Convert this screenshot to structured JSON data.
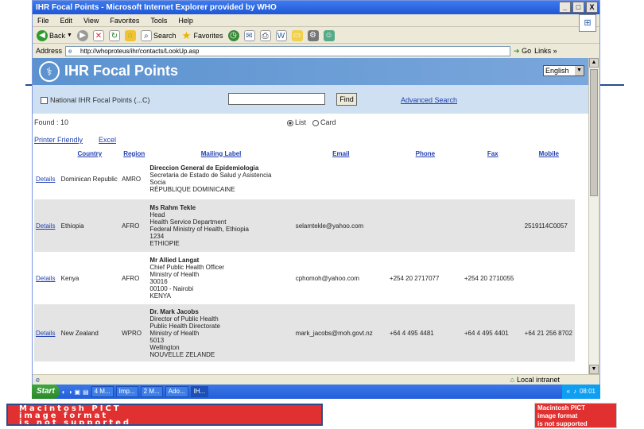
{
  "window": {
    "title": "IHR Focal Points - Microsoft Internet Explorer provided by WHO",
    "min": "_",
    "max": "□",
    "close": "X",
    "menus": [
      "File",
      "Edit",
      "View",
      "Favorites",
      "Tools",
      "Help"
    ],
    "toolbar": {
      "back": "Back",
      "search": "Search",
      "favorites": "Favorites"
    },
    "address_label": "Address",
    "address_value": "http://whoproteus/ihr/contacts/LookUp.asp",
    "go": "Go",
    "links": "Links »"
  },
  "site": {
    "title": "IHR Focal Points",
    "language": "English",
    "search": {
      "checkbox_label": "National IHR Focal Points (...C)",
      "find_button": "Find",
      "advanced_link": "Advanced Search"
    },
    "found_text": "Found : 10",
    "radio_list": "List",
    "radio_card": "Card",
    "printer_friendly": "Printer Friendly",
    "excel": "Excel",
    "columns": [
      "",
      "Country",
      "Region",
      "Mailing Label",
      "Email",
      "Phone",
      "Fax",
      "Mobile"
    ],
    "rows": [
      {
        "details": "Details",
        "country": "Dominican Republic",
        "region": "AMRO",
        "label": [
          "Direccion General de Epidemiologia",
          "Secretaria de Estado de Salud y Asistencia",
          "Socia",
          "RÉPUBLIQUE DOMINICAINE"
        ],
        "email": "",
        "phone": "",
        "fax": "",
        "mobile": ""
      },
      {
        "details": "Details",
        "country": "Ethiopia",
        "region": "AFRO",
        "label": [
          "Ms Rahm Tekle",
          "Head",
          "Health Service Department",
          "Federal Ministry of Health, Ethiopia",
          "1234",
          "ETHIOPIE"
        ],
        "email": "selamtekle@yahoo.com",
        "phone": "",
        "fax": "",
        "mobile": "2519114C0057"
      },
      {
        "details": "Details",
        "country": "Kenya",
        "region": "AFRO",
        "label": [
          "Mr Allied Langat",
          "Chief Public Health Officer",
          "Ministry of Health",
          "30016",
          "00100 - Nairobi",
          "KENYA"
        ],
        "email": "cphomoh@yahoo.com",
        "phone": "+254 20 2717077",
        "fax": "+254 20 2710055",
        "mobile": ""
      },
      {
        "details": "Details",
        "country": "New Zealand",
        "region": "WPRO",
        "label": [
          "Dr. Mark Jacobs",
          "Director of Public Health",
          "Public Health Directorate",
          "Ministry of Health",
          "5013",
          "Wellington",
          "NOUVELLE ZELANDE"
        ],
        "email": "mark_jacobs@moh.govt.nz",
        "phone": "+64 4 495 4481",
        "fax": "+64 4 495 4401",
        "mobile": "+64 21 256 8702"
      }
    ]
  },
  "status": {
    "zone": "Local intranet"
  },
  "taskbar": {
    "start": "Start",
    "items": [
      "4 M...",
      "Imp...",
      "2 M...",
      "Ado...",
      "IH..."
    ],
    "clock": "08:01"
  },
  "placeholders": {
    "left_lines": [
      "Macintosh PICT",
      "image format",
      "is not supported"
    ],
    "right_lines": [
      "Macintosh PICT",
      "image format",
      "is not supported"
    ]
  }
}
